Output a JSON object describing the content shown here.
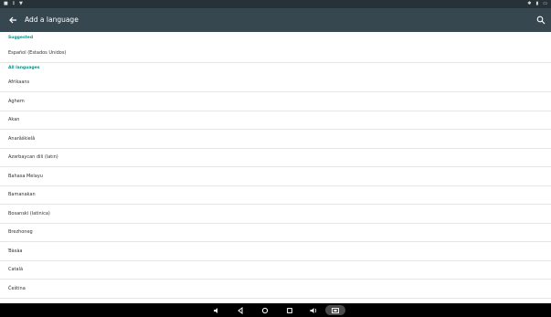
{
  "appbar": {
    "title": "Add a language"
  },
  "sections": {
    "suggested_header": "Suggested",
    "all_header": "All languages"
  },
  "suggested": [
    {
      "label": "Español (Estados Unidos)"
    }
  ],
  "languages": [
    {
      "label": "Afrikaans"
    },
    {
      "label": "Aghem"
    },
    {
      "label": "Akan"
    },
    {
      "label": "Anarâškielâ"
    },
    {
      "label": "Azərbaycan dili (latın)"
    },
    {
      "label": "Bahasa Melayu"
    },
    {
      "label": "Bamanakan"
    },
    {
      "label": "Bosanski (latinica)"
    },
    {
      "label": "Brezhoneg"
    },
    {
      "label": "Ɓàsàa"
    },
    {
      "label": "Català"
    },
    {
      "label": "Čeština"
    }
  ],
  "colors": {
    "statusbar": "#263238",
    "appbar": "#37474f",
    "section_header": "#009688",
    "navbar": "#000000"
  },
  "icons": {
    "back": "arrow-back-icon",
    "search": "search-icon"
  }
}
